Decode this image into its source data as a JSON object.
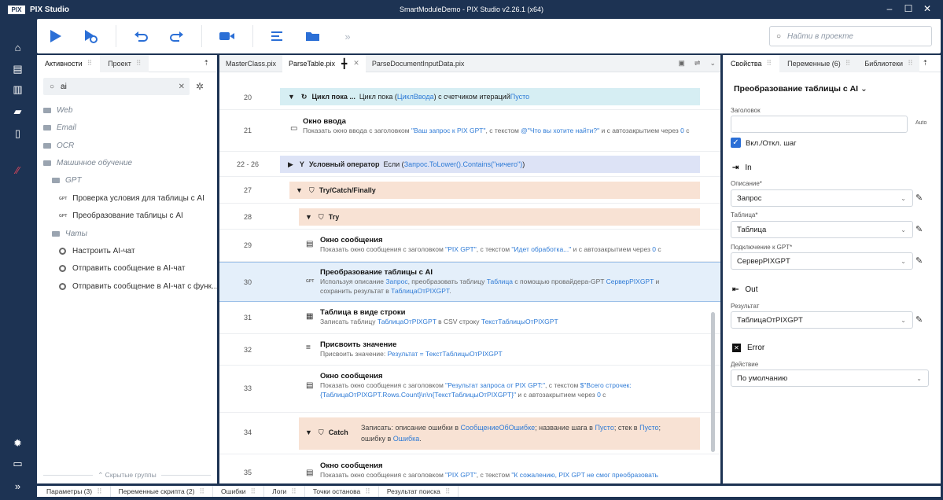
{
  "app": {
    "name": "PIX Studio",
    "window_title": "SmartModuleDemo - PIX Studio v2.26.1 (x64)"
  },
  "toolbar": {
    "search_placeholder": "Найти в проекте",
    "more": "»"
  },
  "left_panel": {
    "tabs": [
      "Активности",
      "Проект"
    ],
    "search_value": "ai",
    "hidden_groups": "⌃ Скрытые группы",
    "items": [
      {
        "label": "Web",
        "type": "group"
      },
      {
        "label": "Email",
        "type": "group"
      },
      {
        "label": "OCR",
        "type": "group"
      },
      {
        "label": "Машинное обучение",
        "type": "group"
      },
      {
        "label": "GPT",
        "type": "group"
      },
      {
        "label": "Проверка условия для таблицы с AI",
        "type": "gpt"
      },
      {
        "label": "Преобразование таблицы с AI",
        "type": "gpt"
      },
      {
        "label": "Чаты",
        "type": "group"
      },
      {
        "label": "Настроить AI-чат",
        "type": "gear"
      },
      {
        "label": "Отправить сообщение в AI-чат",
        "type": "gear"
      },
      {
        "label": "Отправить сообщение в AI-чат с функ...",
        "type": "gear"
      }
    ]
  },
  "editor": {
    "tabs": [
      "MasterClass.pix",
      "ParseTable.pix",
      "ParseDocumentInputData.pix"
    ],
    "rows": {
      "r20": {
        "num": "20",
        "title": "Цикл пока ...",
        "text": "Цикл пока (",
        "l1": "ЦиклВвода",
        "t2": ") с счетчиком итераций ",
        "l2": "Пусто"
      },
      "r21": {
        "num": "21",
        "title": "Окно ввода",
        "d1": "Показать окно ввода с заголовком ",
        "l1": "\"Ваш запрос к PIX GPT\"",
        "d2": ", с текстом ",
        "l2": "@\"Что вы хотите найти?\"",
        "d3": " и с автозакрытием через ",
        "l3": "0",
        "d4": " с"
      },
      "r22": {
        "num": "22 - 26",
        "title": "Условный оператор",
        "text": "Если (",
        "l1": "Запрос.ToLower().Contains(\"ничего\")",
        "t2": ")"
      },
      "r27": {
        "num": "27",
        "title": "Try/Catch/Finally"
      },
      "r28": {
        "num": "28",
        "title": "Try"
      },
      "r29": {
        "num": "29",
        "title": "Окно сообщения",
        "d1": "Показать окно сообщения с заголовком ",
        "l1": "\"PIX GPT\"",
        "d2": ", с текстом ",
        "l2": "\"Идет обработка...\"",
        "d3": " и с автозакрытием через ",
        "l3": "0",
        "d4": " с"
      },
      "r30": {
        "num": "30",
        "title": "Преобразование таблицы с AI",
        "d1": "Используя описание ",
        "l1": "Запрос",
        "d2": ", преобразовать таблицу ",
        "l2": "Таблица",
        "d3": " с помощью провайдера-GPT ",
        "l3": "СерверPIXGPT",
        "d4": " и",
        "d5": "сохранить результат в ",
        "l4": "ТаблицаОтPIXGPT",
        "d6": "."
      },
      "r31": {
        "num": "31",
        "title": "Таблица в виде строки",
        "d1": "Записать таблицу ",
        "l1": "ТаблицаОтPIXGPT",
        "d2": " в CSV строку ",
        "l2": "ТекстТаблицыОтPIXGPT"
      },
      "r32": {
        "num": "32",
        "title": "Присвоить значение",
        "d1": "Присвоить значение: ",
        "l1": "Результат = ТекстТаблицыОтPIXGPT"
      },
      "r33": {
        "num": "33",
        "title": "Окно сообщения",
        "d1": "Показать окно сообщения с заголовком ",
        "l1": "\"Результат запроса от PIX GPT:\"",
        "d2": ", с текстом ",
        "l2": "$\"Всего строчек:",
        "l3": "{ТаблицаОтPIXGPT.Rows.Count}\\n\\n{ТекстТаблицыОтPIXGPT}\"",
        "d3": " и с автозакрытием через ",
        "l4": "0",
        "d4": " с"
      },
      "r34": {
        "num": "34",
        "title": "Catch",
        "d1": "Записать: описание ошибки в ",
        "l1": "СообщениеОбОшибке",
        "d2": "; название шага в ",
        "l2": "Пусто",
        "d3": "; стек в ",
        "l3": "Пусто",
        "d4": ";",
        "d5": "ошибку в ",
        "l4": "Ошибка",
        "d6": "."
      },
      "r35": {
        "num": "35",
        "title": "Окно сообщения",
        "d1": "Показать окно сообщения с заголовком ",
        "l1": "\"PIX GPT\"",
        "d2": ", с текстом ",
        "l2": "\"К сожалению, PIX GPT не смог преобразовать"
      }
    }
  },
  "right_panel": {
    "tabs": [
      "Свойства",
      "Переменные (6)",
      "Библиотеки"
    ],
    "title": "Преобразование таблицы с AI",
    "header_label": "Заголовок",
    "auto": "Auto",
    "toggle_label": "Вкл./Откл. шаг",
    "in_label": "In",
    "desc_label": "Описание*",
    "desc_value": "Запрос",
    "table_label": "Таблица*",
    "table_value": "Таблица",
    "conn_label": "Подключение к GPT*",
    "conn_value": "СерверPIXGPT",
    "out_label": "Out",
    "result_label": "Результат",
    "result_value": "ТаблицаОтPIXGPT",
    "error_label": "Error",
    "action_label": "Действие",
    "action_value": "По умолчанию"
  },
  "bottom_tabs": [
    "Параметры (3)",
    "Переменные скрипта (2)",
    "Ошибки",
    "Логи",
    "Точки останова",
    "Результат поиска"
  ],
  "colors": {
    "frame": "#1d3353",
    "loop": "#d6eef3",
    "cond": "#dde3f6",
    "try": "#f8e2d4",
    "selected": "#e4effa",
    "link": "#2f7bd6",
    "accent": "#2b6fd6"
  }
}
